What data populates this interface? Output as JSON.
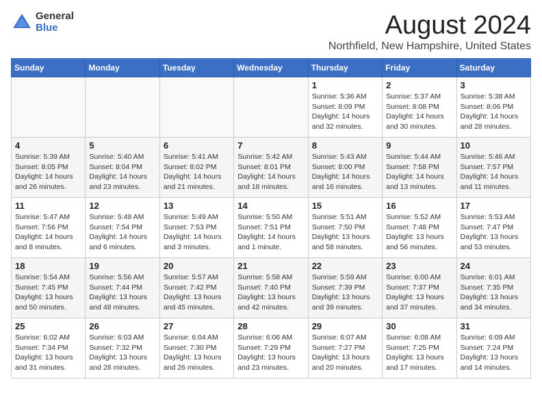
{
  "logo": {
    "general": "General",
    "blue": "Blue"
  },
  "title": "August 2024",
  "location": "Northfield, New Hampshire, United States",
  "weekdays": [
    "Sunday",
    "Monday",
    "Tuesday",
    "Wednesday",
    "Thursday",
    "Friday",
    "Saturday"
  ],
  "weeks": [
    [
      {
        "day": "",
        "info": ""
      },
      {
        "day": "",
        "info": ""
      },
      {
        "day": "",
        "info": ""
      },
      {
        "day": "",
        "info": ""
      },
      {
        "day": "1",
        "info": "Sunrise: 5:36 AM\nSunset: 8:09 PM\nDaylight: 14 hours\nand 32 minutes."
      },
      {
        "day": "2",
        "info": "Sunrise: 5:37 AM\nSunset: 8:08 PM\nDaylight: 14 hours\nand 30 minutes."
      },
      {
        "day": "3",
        "info": "Sunrise: 5:38 AM\nSunset: 8:06 PM\nDaylight: 14 hours\nand 28 minutes."
      }
    ],
    [
      {
        "day": "4",
        "info": "Sunrise: 5:39 AM\nSunset: 8:05 PM\nDaylight: 14 hours\nand 26 minutes."
      },
      {
        "day": "5",
        "info": "Sunrise: 5:40 AM\nSunset: 8:04 PM\nDaylight: 14 hours\nand 23 minutes."
      },
      {
        "day": "6",
        "info": "Sunrise: 5:41 AM\nSunset: 8:02 PM\nDaylight: 14 hours\nand 21 minutes."
      },
      {
        "day": "7",
        "info": "Sunrise: 5:42 AM\nSunset: 8:01 PM\nDaylight: 14 hours\nand 18 minutes."
      },
      {
        "day": "8",
        "info": "Sunrise: 5:43 AM\nSunset: 8:00 PM\nDaylight: 14 hours\nand 16 minutes."
      },
      {
        "day": "9",
        "info": "Sunrise: 5:44 AM\nSunset: 7:58 PM\nDaylight: 14 hours\nand 13 minutes."
      },
      {
        "day": "10",
        "info": "Sunrise: 5:46 AM\nSunset: 7:57 PM\nDaylight: 14 hours\nand 11 minutes."
      }
    ],
    [
      {
        "day": "11",
        "info": "Sunrise: 5:47 AM\nSunset: 7:56 PM\nDaylight: 14 hours\nand 8 minutes."
      },
      {
        "day": "12",
        "info": "Sunrise: 5:48 AM\nSunset: 7:54 PM\nDaylight: 14 hours\nand 6 minutes."
      },
      {
        "day": "13",
        "info": "Sunrise: 5:49 AM\nSunset: 7:53 PM\nDaylight: 14 hours\nand 3 minutes."
      },
      {
        "day": "14",
        "info": "Sunrise: 5:50 AM\nSunset: 7:51 PM\nDaylight: 14 hours\nand 1 minute."
      },
      {
        "day": "15",
        "info": "Sunrise: 5:51 AM\nSunset: 7:50 PM\nDaylight: 13 hours\nand 58 minutes."
      },
      {
        "day": "16",
        "info": "Sunrise: 5:52 AM\nSunset: 7:48 PM\nDaylight: 13 hours\nand 56 minutes."
      },
      {
        "day": "17",
        "info": "Sunrise: 5:53 AM\nSunset: 7:47 PM\nDaylight: 13 hours\nand 53 minutes."
      }
    ],
    [
      {
        "day": "18",
        "info": "Sunrise: 5:54 AM\nSunset: 7:45 PM\nDaylight: 13 hours\nand 50 minutes."
      },
      {
        "day": "19",
        "info": "Sunrise: 5:56 AM\nSunset: 7:44 PM\nDaylight: 13 hours\nand 48 minutes."
      },
      {
        "day": "20",
        "info": "Sunrise: 5:57 AM\nSunset: 7:42 PM\nDaylight: 13 hours\nand 45 minutes."
      },
      {
        "day": "21",
        "info": "Sunrise: 5:58 AM\nSunset: 7:40 PM\nDaylight: 13 hours\nand 42 minutes."
      },
      {
        "day": "22",
        "info": "Sunrise: 5:59 AM\nSunset: 7:39 PM\nDaylight: 13 hours\nand 39 minutes."
      },
      {
        "day": "23",
        "info": "Sunrise: 6:00 AM\nSunset: 7:37 PM\nDaylight: 13 hours\nand 37 minutes."
      },
      {
        "day": "24",
        "info": "Sunrise: 6:01 AM\nSunset: 7:35 PM\nDaylight: 13 hours\nand 34 minutes."
      }
    ],
    [
      {
        "day": "25",
        "info": "Sunrise: 6:02 AM\nSunset: 7:34 PM\nDaylight: 13 hours\nand 31 minutes."
      },
      {
        "day": "26",
        "info": "Sunrise: 6:03 AM\nSunset: 7:32 PM\nDaylight: 13 hours\nand 28 minutes."
      },
      {
        "day": "27",
        "info": "Sunrise: 6:04 AM\nSunset: 7:30 PM\nDaylight: 13 hours\nand 26 minutes."
      },
      {
        "day": "28",
        "info": "Sunrise: 6:06 AM\nSunset: 7:29 PM\nDaylight: 13 hours\nand 23 minutes."
      },
      {
        "day": "29",
        "info": "Sunrise: 6:07 AM\nSunset: 7:27 PM\nDaylight: 13 hours\nand 20 minutes."
      },
      {
        "day": "30",
        "info": "Sunrise: 6:08 AM\nSunset: 7:25 PM\nDaylight: 13 hours\nand 17 minutes."
      },
      {
        "day": "31",
        "info": "Sunrise: 6:09 AM\nSunset: 7:24 PM\nDaylight: 13 hours\nand 14 minutes."
      }
    ]
  ]
}
